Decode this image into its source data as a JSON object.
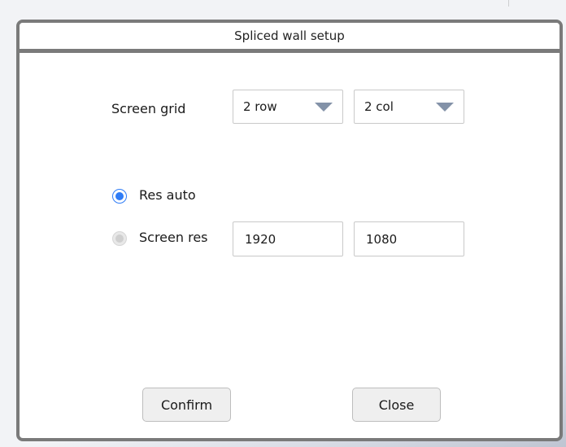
{
  "dialog": {
    "title": "Spliced wall setup"
  },
  "screen_grid": {
    "label": "Screen grid",
    "rows_value": "2 row",
    "cols_value": "2 col"
  },
  "resolution": {
    "auto_label": "Res auto",
    "auto_selected": true,
    "manual_label": "Screen res",
    "manual_selected": false,
    "width_value": "1920",
    "height_value": "1080"
  },
  "buttons": {
    "confirm_label": "Confirm",
    "close_label": "Close"
  },
  "colors": {
    "radio_checked": "#2f7cf6",
    "dropdown_arrow": "#8392a8",
    "dialog_border": "#7a7a7a"
  },
  "icons": {
    "dropdown": "chevron-down-icon",
    "radio_on": "radio-checked-icon",
    "radio_off": "radio-unchecked-icon"
  }
}
